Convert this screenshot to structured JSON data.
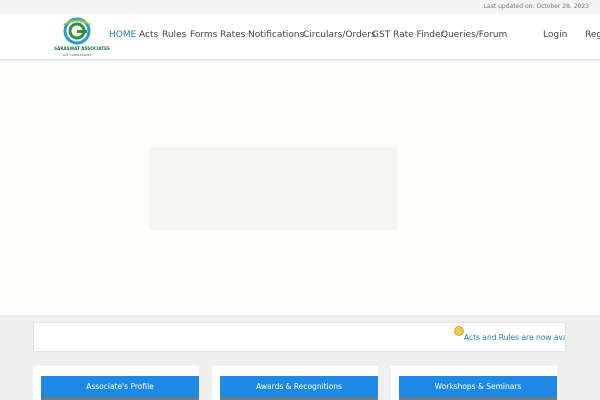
{
  "topbar": {
    "last_updated": "Last updated on: October 28, 2023"
  },
  "header": {
    "logo": {
      "brand": "SARASWAT ASSOCIATES",
      "tagline": "GST CONSULTANTS"
    },
    "nav": [
      "HOME",
      "Acts",
      "Rules",
      "Forms",
      "Rates",
      "Notifications",
      "Circulars/Orders",
      "GST Rate Finder",
      "Queries/Forum"
    ],
    "active_nav": "HOME",
    "login": "Login",
    "register": "Reg"
  },
  "ticker": {
    "text": "Acts and Rules are now availa",
    "icon": "smiley-icon"
  },
  "cards": [
    {
      "title": "Associate's Profile"
    },
    {
      "title": "Awards & Recognitions"
    },
    {
      "title": "Workshops & Seminars"
    }
  ],
  "colors": {
    "accent": "#1e88e5",
    "link": "#1e7fb8",
    "brand_green": "#1f7a3a"
  }
}
